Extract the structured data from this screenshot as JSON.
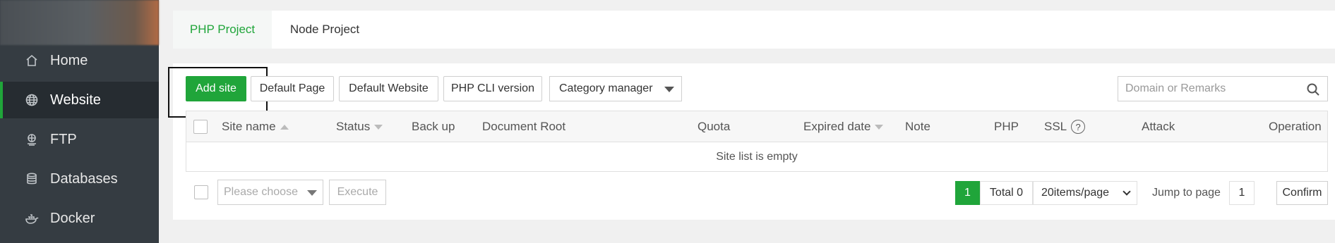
{
  "sidebar": {
    "items": [
      {
        "label": "Home",
        "icon": "home-icon"
      },
      {
        "label": "Website",
        "icon": "globe-icon",
        "active": true
      },
      {
        "label": "FTP",
        "icon": "ftp-icon"
      },
      {
        "label": "Databases",
        "icon": "database-icon"
      },
      {
        "label": "Docker",
        "icon": "docker-icon"
      }
    ]
  },
  "tabs": [
    {
      "label": "PHP Project",
      "active": true
    },
    {
      "label": "Node Project"
    }
  ],
  "toolbar": {
    "add_site": "Add site",
    "default_page": "Default Page",
    "default_website": "Default Website",
    "php_cli_version": "PHP CLI version",
    "category_manager": "Category manager",
    "search_placeholder": "Domain or Remarks"
  },
  "table": {
    "columns": [
      "Site name",
      "Status",
      "Back up",
      "Document Root",
      "Quota",
      "Expired date",
      "Note",
      "PHP",
      "SSL",
      "Attack",
      "Operation"
    ],
    "empty_text": "Site list is empty"
  },
  "footer": {
    "batch_placeholder": "Please choose",
    "execute": "Execute",
    "current_page": "1",
    "total": "Total 0",
    "per_page": "20items/page",
    "jump_label": "Jump to page",
    "jump_value": "1",
    "confirm": "Confirm"
  },
  "colors": {
    "accent": "#20a53a",
    "sidebar_bg": "#353c42",
    "sidebar_active_bg": "#262c31"
  }
}
